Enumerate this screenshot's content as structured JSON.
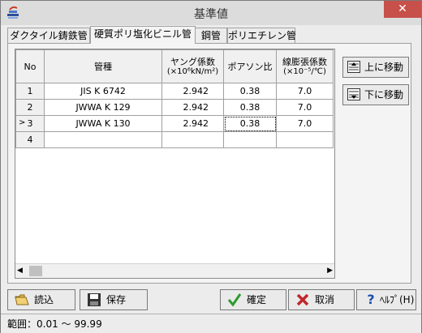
{
  "window": {
    "title": "基準値",
    "close_glyph": "✕"
  },
  "tabs": [
    {
      "label": "ダクタイル鋳鉄管"
    },
    {
      "label": "硬質ポリ塩化ビニル管"
    },
    {
      "label": "鋼管"
    },
    {
      "label": "ポリエチレン管"
    }
  ],
  "table": {
    "headers": {
      "no": "No",
      "pipe": "管種",
      "young_1": "ヤング係数",
      "young_2": "(×10⁶kN/m²)",
      "poisson": "ポアソン比",
      "thermal_1": "線膨張係数",
      "thermal_2": "(×10⁻⁵/℃)"
    },
    "rows": [
      {
        "no": "1",
        "pipe": "JIS K 6742",
        "young": "2.942",
        "poisson": "0.38",
        "thermal": "7.0"
      },
      {
        "no": "2",
        "pipe": "JWWA K 129",
        "young": "2.942",
        "poisson": "0.38",
        "thermal": "7.0"
      },
      {
        "no": "3",
        "pipe": "JWWA K 130",
        "young": "2.942",
        "poisson": "0.38",
        "thermal": "7.0"
      },
      {
        "no": "4",
        "pipe": "",
        "young": "",
        "poisson": "",
        "thermal": ""
      }
    ],
    "current_row_marker": ">"
  },
  "side_buttons": {
    "up": "上に移動",
    "down": "下に移動"
  },
  "bottom_buttons": {
    "load": "読込",
    "save": "保存",
    "ok": "確定",
    "cancel": "取消",
    "help": "ﾍﾙﾌﾟ(H)"
  },
  "status": {
    "text": "範囲：0.01 ～ 99.99"
  },
  "colors": {
    "close_button": "#c7504b",
    "ok_check": "#2e9b2e",
    "cancel_x": "#c0282d",
    "help_icon": "#1a4fb0"
  }
}
